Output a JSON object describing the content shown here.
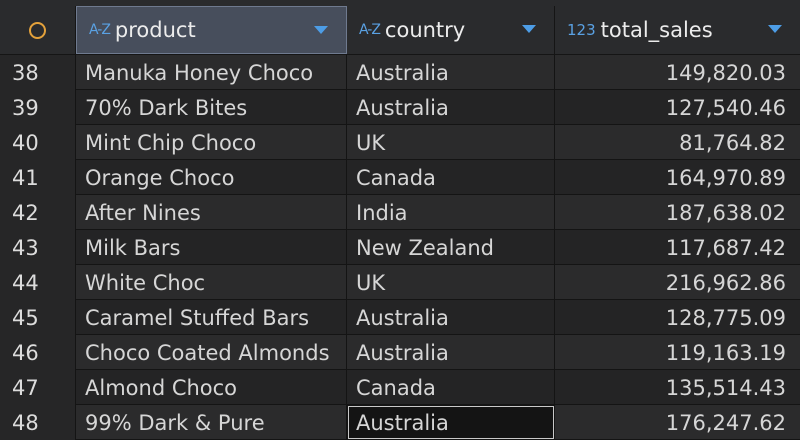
{
  "columns": {
    "product": {
      "type_icon": "A-Z",
      "label": "product"
    },
    "country": {
      "type_icon": "A-Z",
      "label": "country"
    },
    "total_sales": {
      "type_icon": "123",
      "label": "total_sales"
    }
  },
  "rows": [
    {
      "num": "38",
      "product": "Manuka Honey Choco",
      "country": "Australia",
      "total_sales": "149,820.03"
    },
    {
      "num": "39",
      "product": "70% Dark Bites",
      "country": "Australia",
      "total_sales": "127,540.46"
    },
    {
      "num": "40",
      "product": "Mint Chip Choco",
      "country": "UK",
      "total_sales": "81,764.82"
    },
    {
      "num": "41",
      "product": "Orange Choco",
      "country": "Canada",
      "total_sales": "164,970.89"
    },
    {
      "num": "42",
      "product": "After Nines",
      "country": "India",
      "total_sales": "187,638.02"
    },
    {
      "num": "43",
      "product": "Milk Bars",
      "country": "New Zealand",
      "total_sales": "117,687.42"
    },
    {
      "num": "44",
      "product": "White Choc",
      "country": "UK",
      "total_sales": "216,962.86"
    },
    {
      "num": "45",
      "product": "Caramel Stuffed Bars",
      "country": "Australia",
      "total_sales": "128,775.09"
    },
    {
      "num": "46",
      "product": "Choco Coated Almonds",
      "country": "Australia",
      "total_sales": "119,163.19"
    },
    {
      "num": "47",
      "product": "Almond Choco",
      "country": "Canada",
      "total_sales": "135,514.43"
    },
    {
      "num": "48",
      "product": "99% Dark & Pure",
      "country": "Australia",
      "total_sales": "176,247.62"
    }
  ],
  "colors": {
    "accent": "#4d9de6",
    "selected_header": "#474e5c",
    "corner_ring": "#e3a13b"
  }
}
